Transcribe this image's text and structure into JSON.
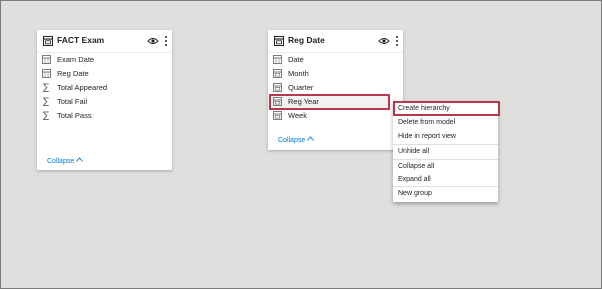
{
  "tables": [
    {
      "title": "FACT Exam",
      "fields": [
        {
          "label": "Exam Date",
          "icon": "calendar-icon"
        },
        {
          "label": "Reg Date",
          "icon": "calendar-icon"
        },
        {
          "label": "Total Appeared",
          "icon": "sigma-icon"
        },
        {
          "label": "Total Fail",
          "icon": "sigma-icon"
        },
        {
          "label": "Total Pass",
          "icon": "sigma-icon"
        }
      ],
      "collapse_label": "Collapse"
    },
    {
      "title": "Reg Date",
      "fields": [
        {
          "label": "Date",
          "icon": "calendar-icon"
        },
        {
          "label": "Month",
          "icon": "table-field-icon"
        },
        {
          "label": "Quarter",
          "icon": "table-field-icon"
        },
        {
          "label": "Reg Year",
          "icon": "table-field-icon"
        },
        {
          "label": "Week",
          "icon": "table-field-icon"
        }
      ],
      "collapse_label": "Collapse"
    }
  ],
  "context_menu": {
    "items": [
      "Create hierarchy",
      "Delete from model",
      "Hide in report view",
      "Unhide all",
      "Collapse all",
      "Expand all",
      "New group"
    ]
  },
  "colors": {
    "canvas": "#e1dfdd",
    "highlight_border": "#b5394a",
    "link": "#0078d4"
  }
}
